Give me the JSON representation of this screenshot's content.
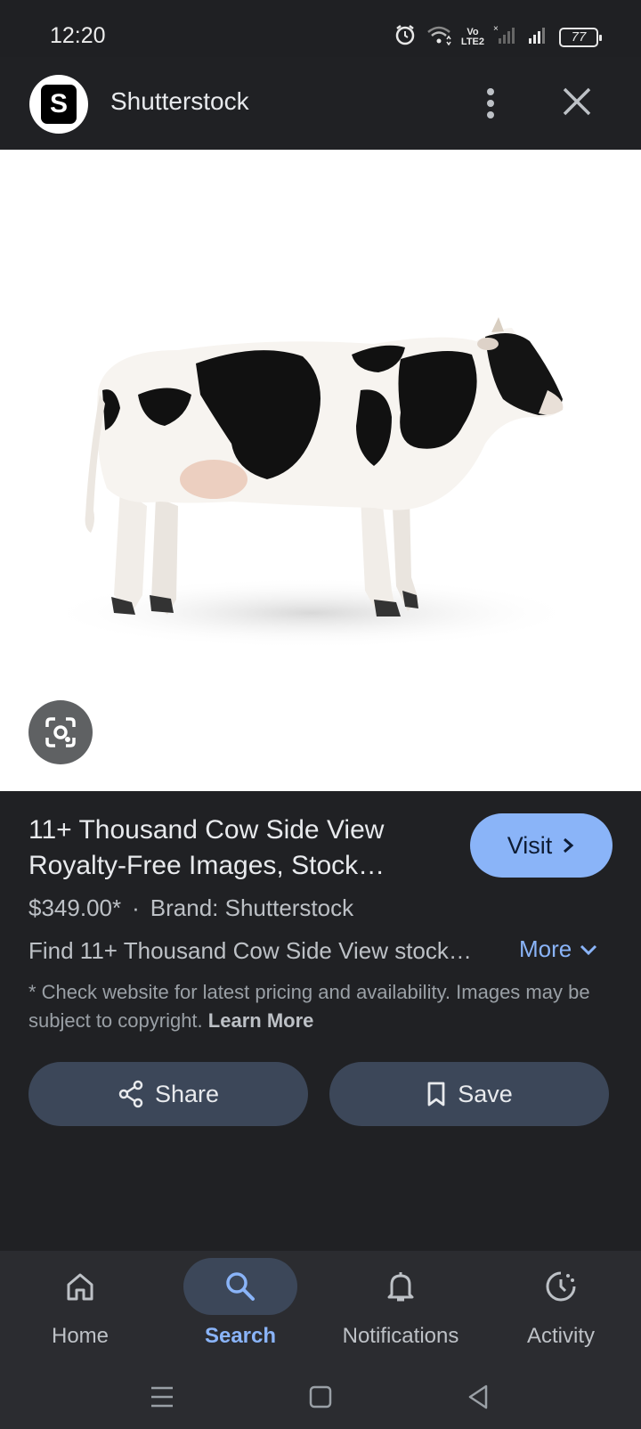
{
  "status": {
    "time": "12:20",
    "volte": "Vo\nLTE2",
    "battery": "77"
  },
  "header": {
    "site_name": "Shutterstock",
    "logo_letter": "S"
  },
  "result": {
    "title": "11+ Thousand Cow Side View Royalty-Free Images, Stock…",
    "visit_label": "Visit",
    "price": "$349.00*",
    "separator": "·",
    "brand": "Brand: Shutterstock",
    "description": "Find 11+ Thousand Cow Side View stock…",
    "more_label": "More",
    "disclaimer": "* Check website for latest pricing and availability. Images may be subject to copyright.",
    "learn_more": "Learn More",
    "share_label": "Share",
    "save_label": "Save"
  },
  "bottom_nav": {
    "items": [
      {
        "label": "Home",
        "icon": "home-icon"
      },
      {
        "label": "Search",
        "icon": "search-icon",
        "active": true
      },
      {
        "label": "Notifications",
        "icon": "bell-icon"
      },
      {
        "label": "Activity",
        "icon": "activity-icon"
      }
    ]
  },
  "colors": {
    "accent": "#8ab4f8",
    "background": "#202124",
    "button": "#3c4759"
  }
}
